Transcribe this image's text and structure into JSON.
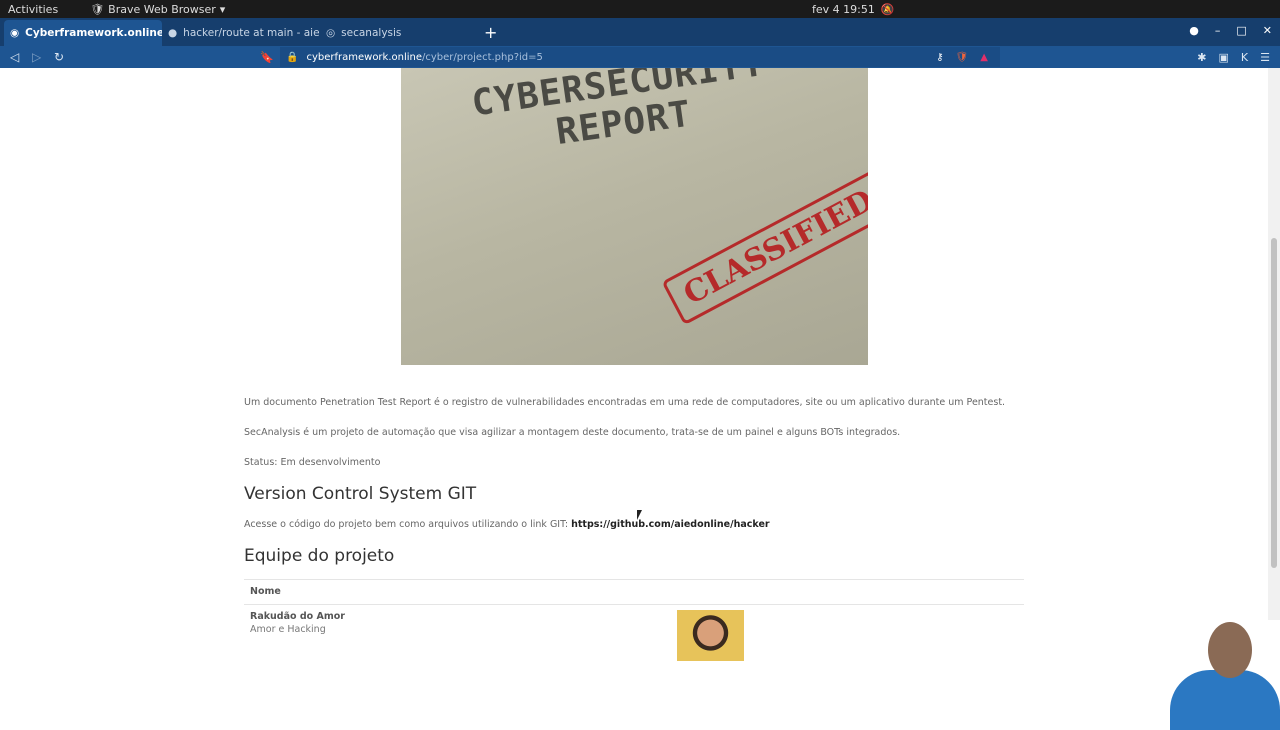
{
  "os": {
    "activities": "Activities",
    "app_name": "Brave Web Browser",
    "clock": "fev 4  19:51"
  },
  "tabs": [
    {
      "label": "Cyberframework.online",
      "active": true
    },
    {
      "label": "hacker/route at main - aiedon"
    },
    {
      "label": "secanalysis"
    }
  ],
  "url": {
    "domain": "cyberframework.online",
    "path": "/cyber/project.php?id=5"
  },
  "hero": {
    "title": "CYBERSECURITY REPORT",
    "stamp": "CLASSIFIED"
  },
  "content": {
    "p1": "Um documento Penetration Test Report é o registro de vulnerabilidades encontradas em uma rede de computadores, site ou um aplicativo durante um Pentest.",
    "p2": "SecAnalysis é um projeto de automação que visa agilizar a montagem deste documento, trata-se de um painel e alguns BOTs integrados.",
    "status": "Status: Em desenvolvimento",
    "vcs_heading": "Version Control System GIT",
    "git_text": "Acesse o código do projeto bem como arquivos utilizando o link GIT: ",
    "git_link": "https://github.com/aiedonline/hacker",
    "team_heading": "Equipe do projeto",
    "table_header": "Nome",
    "members": [
      {
        "name": "Rakudão do Amor",
        "role": "Amor e Hacking"
      }
    ]
  }
}
